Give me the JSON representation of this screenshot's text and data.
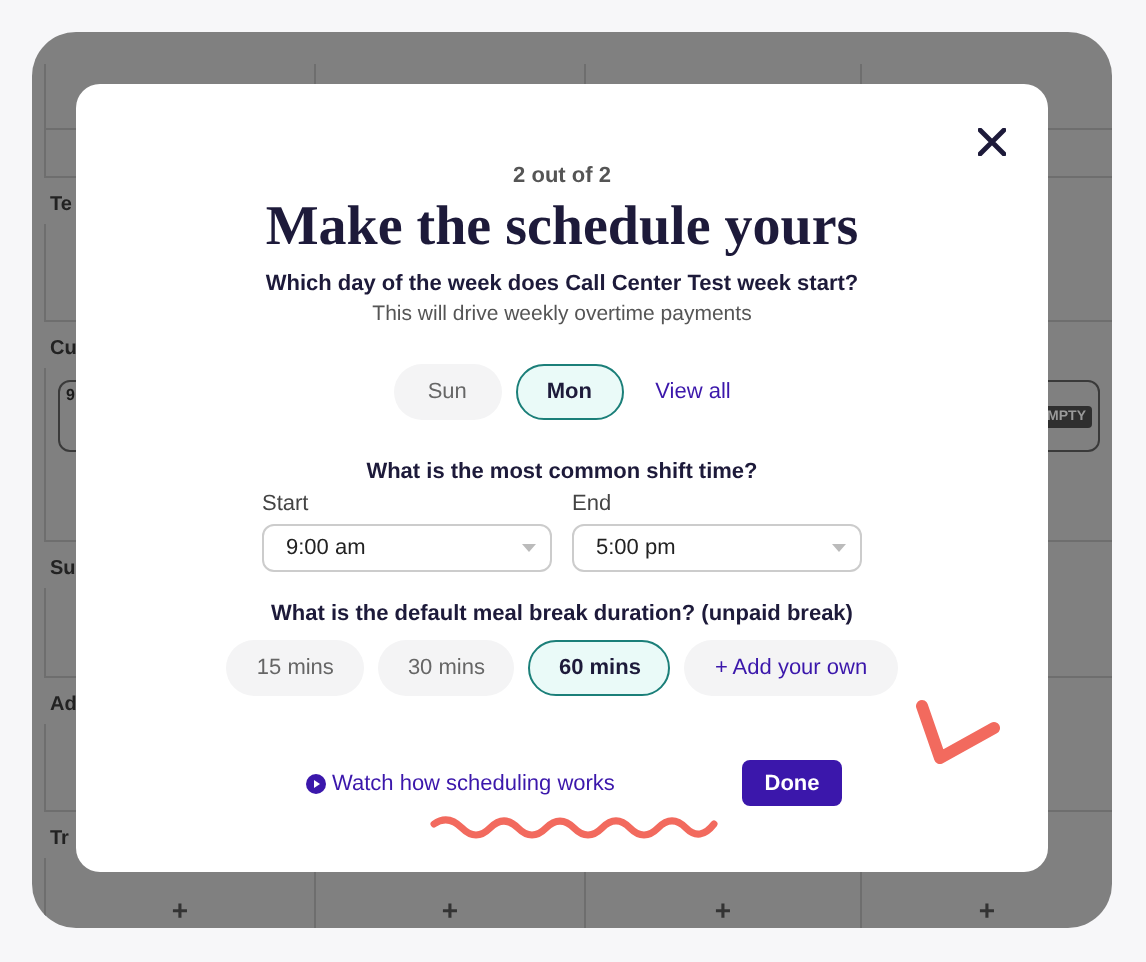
{
  "background_schedule": {
    "rows": [
      {
        "label": "Te"
      },
      {
        "label": "Cu",
        "shift": "9",
        "badge": "MPTY"
      },
      {
        "label": "Su"
      },
      {
        "label": "Ad"
      },
      {
        "label": "Tr"
      }
    ],
    "add_buttons": [
      "+",
      "+",
      "+",
      "+"
    ]
  },
  "modal": {
    "step": "2 out of 2",
    "title": "Make the schedule yours",
    "week_start": {
      "question": "Which day of the week does Call Center Test week start?",
      "hint": "This will drive weekly overtime payments",
      "options": [
        {
          "label": "Sun",
          "selected": false
        },
        {
          "label": "Mon",
          "selected": true
        }
      ],
      "link": "View all"
    },
    "shift_time": {
      "question": "What is the most common shift time?",
      "start_label": "Start",
      "start_value": "9:00 am",
      "end_label": "End",
      "end_value": "5:00 pm"
    },
    "meal_break": {
      "question": "What is the default meal break duration? (unpaid break)",
      "options": [
        {
          "label": "15 mins",
          "selected": false
        },
        {
          "label": "30 mins",
          "selected": false
        },
        {
          "label": "60 mins",
          "selected": true
        }
      ],
      "link": "+ Add your own"
    },
    "watch_link": "Watch how scheduling works",
    "done_button": "Done"
  }
}
